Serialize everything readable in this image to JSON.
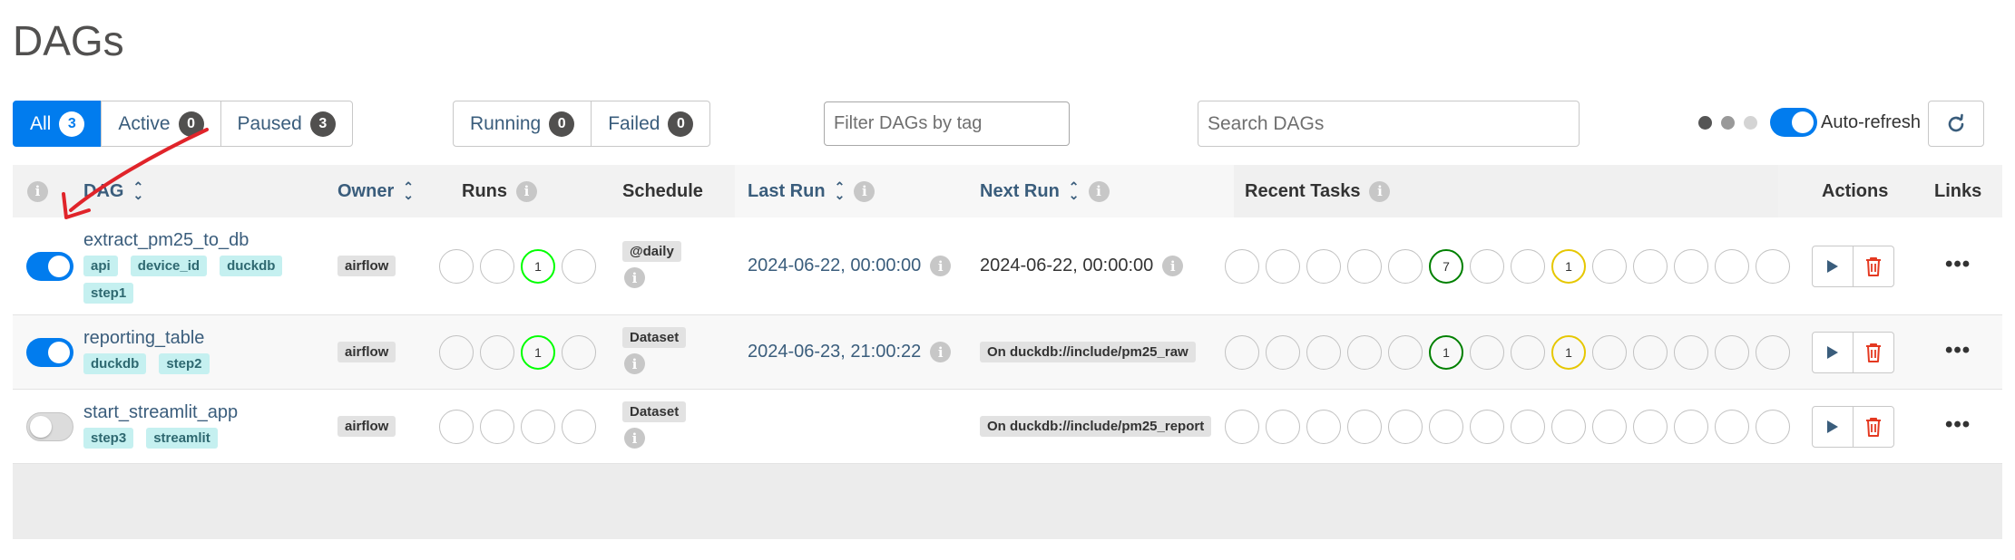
{
  "page": {
    "title": "DAGs"
  },
  "filters": {
    "status_tabs": [
      {
        "label": "All",
        "count": "3"
      },
      {
        "label": "Active",
        "count": "0"
      },
      {
        "label": "Paused",
        "count": "3"
      }
    ],
    "run_tabs": [
      {
        "label": "Running",
        "count": "0"
      },
      {
        "label": "Failed",
        "count": "0"
      }
    ],
    "tag_filter_placeholder": "Filter DAGs by tag",
    "search_placeholder": "Search DAGs",
    "auto_refresh_label": "Auto-refresh",
    "auto_refresh_on": true
  },
  "colors": {
    "accent": "#017cee",
    "success": "#008000",
    "running": "#00ff00",
    "queued": "#e6c700",
    "delete": "#e43921"
  },
  "icons": {
    "info": "info-icon",
    "sort": "sort-icon",
    "refresh": "refresh-icon",
    "trigger": "play-icon",
    "delete": "trash-icon",
    "links": "more-icon"
  },
  "table": {
    "headers": {
      "dag": "DAG",
      "owner": "Owner",
      "runs": "Runs",
      "schedule": "Schedule",
      "last_run": "Last Run",
      "next_run": "Next Run",
      "recent_tasks": "Recent Tasks",
      "actions": "Actions",
      "links": "Links"
    },
    "rows": [
      {
        "dag_id": "extract_pm25_to_db",
        "active": true,
        "tags": [
          "api",
          "device_id",
          "duckdb",
          "step1"
        ],
        "owner": "airflow",
        "runs": [
          "",
          "",
          "1",
          ""
        ],
        "schedule": "@daily",
        "last_run": "2024-06-22, 00:00:00",
        "next_run": "2024-06-22, 00:00:00",
        "recent_tasks": [
          "",
          "",
          "",
          "",
          "",
          "7",
          "",
          "",
          "1",
          "",
          "",
          "",
          "",
          ""
        ]
      },
      {
        "dag_id": "reporting_table",
        "active": true,
        "tags": [
          "duckdb",
          "step2"
        ],
        "owner": "airflow",
        "runs": [
          "",
          "",
          "1",
          ""
        ],
        "schedule": "Dataset",
        "last_run": "2024-06-23, 21:00:22",
        "next_run": "On duckdb://include/pm25_raw",
        "recent_tasks": [
          "",
          "",
          "",
          "",
          "",
          "1",
          "",
          "",
          "1",
          "",
          "",
          "",
          "",
          ""
        ]
      },
      {
        "dag_id": "start_streamlit_app",
        "active": false,
        "tags": [
          "step3",
          "streamlit"
        ],
        "owner": "airflow",
        "runs": [
          "",
          "",
          "",
          ""
        ],
        "schedule": "Dataset",
        "last_run": "",
        "next_run": "On duckdb://include/pm25_report",
        "recent_tasks": [
          "",
          "",
          "",
          "",
          "",
          "",
          "",
          "",
          "",
          "",
          "",
          "",
          "",
          ""
        ]
      }
    ]
  }
}
